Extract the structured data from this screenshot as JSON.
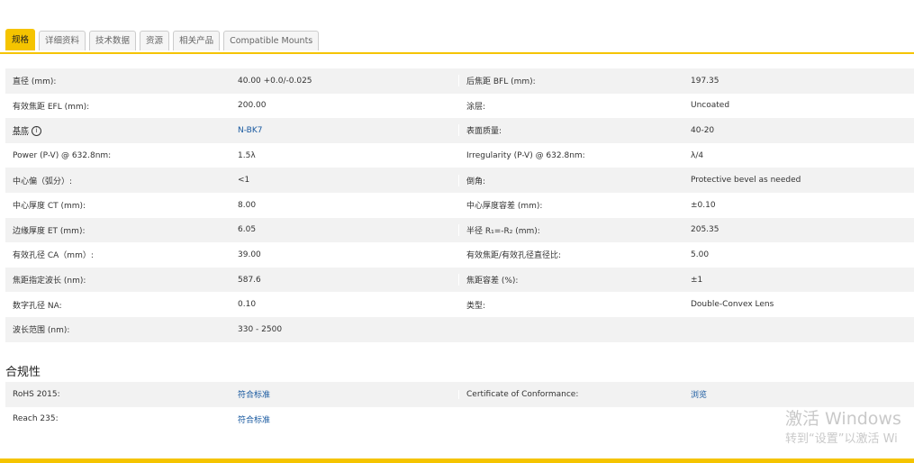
{
  "tabs": [
    "规格",
    "详细资料",
    "技术数据",
    "资源",
    "相关产品",
    "Compatible Mounts"
  ],
  "specs": [
    {
      "l1": "直径 (mm):",
      "v1": "40.00 +0.0/-0.025",
      "l2": "后焦距 BFL (mm):",
      "v2": "197.35"
    },
    {
      "l1": "有效焦距 EFL (mm):",
      "v1": "200.00",
      "l2": "涂层:",
      "v2": "Uncoated"
    },
    {
      "l1": "基底",
      "v1": "N-BK7",
      "l2": "表面质量:",
      "v2": "40-20"
    },
    {
      "l1": "Power (P-V) @ 632.8nm:",
      "v1": "1.5λ",
      "l2": "Irregularity (P-V) @ 632.8nm:",
      "v2": "λ/4"
    },
    {
      "l1": "中心偏（弧分）:",
      "v1": "<1",
      "l2": "倒角:",
      "v2": "Protective bevel as needed"
    },
    {
      "l1": "中心厚度 CT (mm):",
      "v1": "8.00",
      "l2": "中心厚度容差 (mm):",
      "v2": "±0.10"
    },
    {
      "l1": "边缘厚度 ET (mm):",
      "v1": "6.05",
      "l2": "半径 R₁=-R₂ (mm):",
      "v2": "205.35"
    },
    {
      "l1": "有效孔径 CA（mm）:",
      "v1": "39.00",
      "l2": "有效焦距/有效孔径直径比:",
      "v2": "5.00"
    },
    {
      "l1": "焦距指定波长 (nm):",
      "v1": "587.6",
      "l2": "焦距容差 (%):",
      "v2": "±1"
    },
    {
      "l1": "数字孔径 NA:",
      "v1": "0.10",
      "l2": "类型:",
      "v2": "Double-Convex Lens"
    },
    {
      "l1": "波长范围 (nm):",
      "v1": "330 - 2500",
      "l2": "",
      "v2": ""
    }
  ],
  "info_glyph": "i",
  "compliance": {
    "title": "合规性",
    "rows": [
      {
        "l1": "RoHS 2015:",
        "v1": "符合标准",
        "l2": "Certificate of Conformance:",
        "v2": "浏览"
      },
      {
        "l1": "Reach 235:",
        "v1": "符合标准",
        "l2": "",
        "v2": ""
      }
    ]
  },
  "watermark": {
    "line1": "激活 Windows",
    "line2": "转到“设置”以激活 Wi"
  },
  "colors": {
    "accent": "#f5c400",
    "link": "#1a5aa0"
  }
}
